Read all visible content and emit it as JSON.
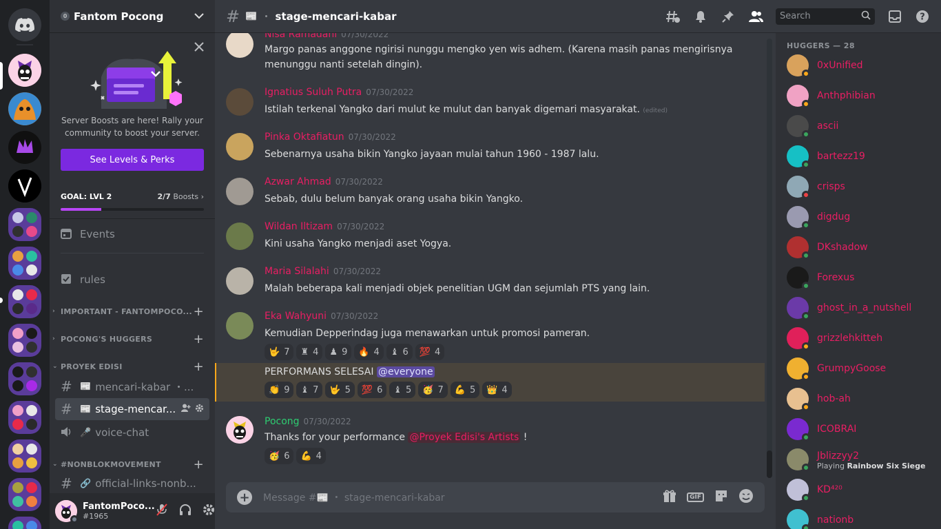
{
  "server": {
    "name": "Fantom Pocong",
    "boost_badge": "0"
  },
  "boost_card": {
    "text": "Server Boosts are here! Rally your community to boost your server.",
    "button": "See Levels & Perks"
  },
  "goal": {
    "label": "GOAL: LVL 2",
    "current": "2/7",
    "unit": "Boosts",
    "progress": 0.286
  },
  "channels": {
    "events": "Events",
    "rules": "rules",
    "categories": [
      "IMPORTANT - FANTOMPOCO...",
      "POCONG'S HUGGERS",
      "PROYEK EDISI",
      "#NONBLOKMOVEMENT"
    ],
    "items": [
      {
        "emoji": "📰",
        "label": "mencari-kabar ・..."
      },
      {
        "emoji": "📰",
        "label": "stage-mencar..."
      },
      {
        "emoji": "🎤",
        "label": "voice-chat"
      },
      {
        "emoji": "🔗",
        "label": "official-links-nonb..."
      }
    ]
  },
  "user": {
    "name": "FantomPoco...",
    "tag": "#1965"
  },
  "header": {
    "channel_emoji": "📰",
    "channel_name": "stage-mencari-kabar",
    "search_placeholder": "Search"
  },
  "messages": [
    {
      "name": "Nisa Ramadani",
      "time": "07/30/2022",
      "text": "Margo panas anggone ngirisi nunggu mengko yen wis adhem. (Karena masih panas mengirisnya menunggu nanti setelah dingin).",
      "avatar_color": "#e8d9c8"
    },
    {
      "name": "Ignatius Suluh Putra",
      "time": "07/30/2022",
      "text": "Istilah terkenal Yangko dari mulut ke mulut dan banyak digemari masyarakat.",
      "edited": "(edited)",
      "avatar_color": "#5b4b3a"
    },
    {
      "name": "Pinka Oktafiatun",
      "time": "07/30/2022",
      "text": "Sebenarnya usaha bikin Yangko jayaan mulai tahun 1960 - 1987 lalu.",
      "avatar_color": "#c9a45e"
    },
    {
      "name": "Azwar Ahmad",
      "time": "07/30/2022",
      "text": "Sebab, dulu belum banyak orang usaha bikin Yangko.",
      "avatar_color": "#a09a93"
    },
    {
      "name": "Wildan Iltizam",
      "time": "07/30/2022",
      "text": "Kini usaha Yangko menjadi aset Yogya.",
      "avatar_color": "#6b7a4a"
    },
    {
      "name": "Maria Silalahi",
      "time": "07/30/2022",
      "text": "Malah beberapa kali menjadi objek penelitian UGM dan sejumlah PTS yang lain.",
      "avatar_color": "#b9b3a8"
    },
    {
      "name": "Eka Wahyuni",
      "time": "07/30/2022",
      "text": "Kemudian Depperindag juga menawarkan untuk promosi pameran.",
      "avatar_color": "#7a8a58"
    }
  ],
  "reactions_eka": [
    {
      "emoji": "🤟",
      "count": "7"
    },
    {
      "emoji": "♜",
      "count": "4"
    },
    {
      "emoji": "♟",
      "count": "9"
    },
    {
      "emoji": "🔥",
      "count": "4"
    },
    {
      "emoji": "♝",
      "count": "6"
    },
    {
      "emoji": "💯",
      "count": "4"
    }
  ],
  "highlight_message": {
    "text": "PERFORMANS SELESAI",
    "mention": "@everyone",
    "reactions": [
      {
        "emoji": "👏",
        "count": "9"
      },
      {
        "emoji": "♝",
        "count": "7"
      },
      {
        "emoji": "🤟",
        "count": "5"
      },
      {
        "emoji": "💯",
        "count": "6"
      },
      {
        "emoji": "♝",
        "count": "5"
      },
      {
        "emoji": "🥳",
        "count": "7"
      },
      {
        "emoji": "💪",
        "count": "5"
      },
      {
        "emoji": "👑",
        "count": "4"
      }
    ]
  },
  "pocong_message": {
    "name": "Pocong",
    "time": "07/30/2022",
    "text": "Thanks for your performance",
    "role_mention": "@Proyek Edisi's Artists",
    "after": "!",
    "reactions": [
      {
        "emoji": "🥳",
        "count": "6"
      },
      {
        "emoji": "💪",
        "count": "4"
      }
    ]
  },
  "composer": {
    "placeholder": "Message #📰 ・ stage-mencari-kabar",
    "gif": "GIF"
  },
  "members_header": "HUGGERS — 28",
  "members": [
    {
      "name": "0xUnified",
      "color": "#d9a25c",
      "status": "#faa81a"
    },
    {
      "name": "Anthphibian",
      "color": "#f0a2c4",
      "status": "#faa81a"
    },
    {
      "name": "ascii",
      "color": "#4a4a4a",
      "status": "#3ba55d"
    },
    {
      "name": "bartezz19",
      "color": "#16c0c5",
      "status": "#3ba55d"
    },
    {
      "name": "crisps",
      "color": "#8fa8b5",
      "status": "#ed4245"
    },
    {
      "name": "digdug",
      "color": "#9a9ab0",
      "status": "#3ba55d"
    },
    {
      "name": "DKshadow",
      "color": "#b03030",
      "status": "#3ba55d"
    },
    {
      "name": "Forexus",
      "color": "#1a1a1a",
      "status": "#3ba55d"
    },
    {
      "name": "ghost_in_a_nutshell",
      "color": "#6b3aa8",
      "status": "#3ba55d"
    },
    {
      "name": "grizzlehkitteh",
      "color": "#e0205a",
      "status": "#faa81a"
    },
    {
      "name": "GrumpyGoose",
      "color": "#f0b030",
      "status": "#faa81a"
    },
    {
      "name": "hob-ah",
      "color": "#e8c090",
      "status": "#faa81a"
    },
    {
      "name": "ICOBRAI",
      "color": "#7a2ad0",
      "status": "#3ba55d"
    },
    {
      "name": "Jblizzyy2",
      "color": "#8a8a6a",
      "status": "#3ba55d",
      "activity": "Playing",
      "game": "Rainbow Six Siege"
    },
    {
      "name": "KD⁴²⁰",
      "color": "#c0c0d8",
      "status": "#3ba55d"
    },
    {
      "name": "nationb",
      "color": "#40c0d0",
      "status": "#3ba55d"
    }
  ],
  "colors": {
    "accent": "#7b29e0",
    "name_pink": "#e91e63",
    "pocong_green": "#2ecc71"
  }
}
